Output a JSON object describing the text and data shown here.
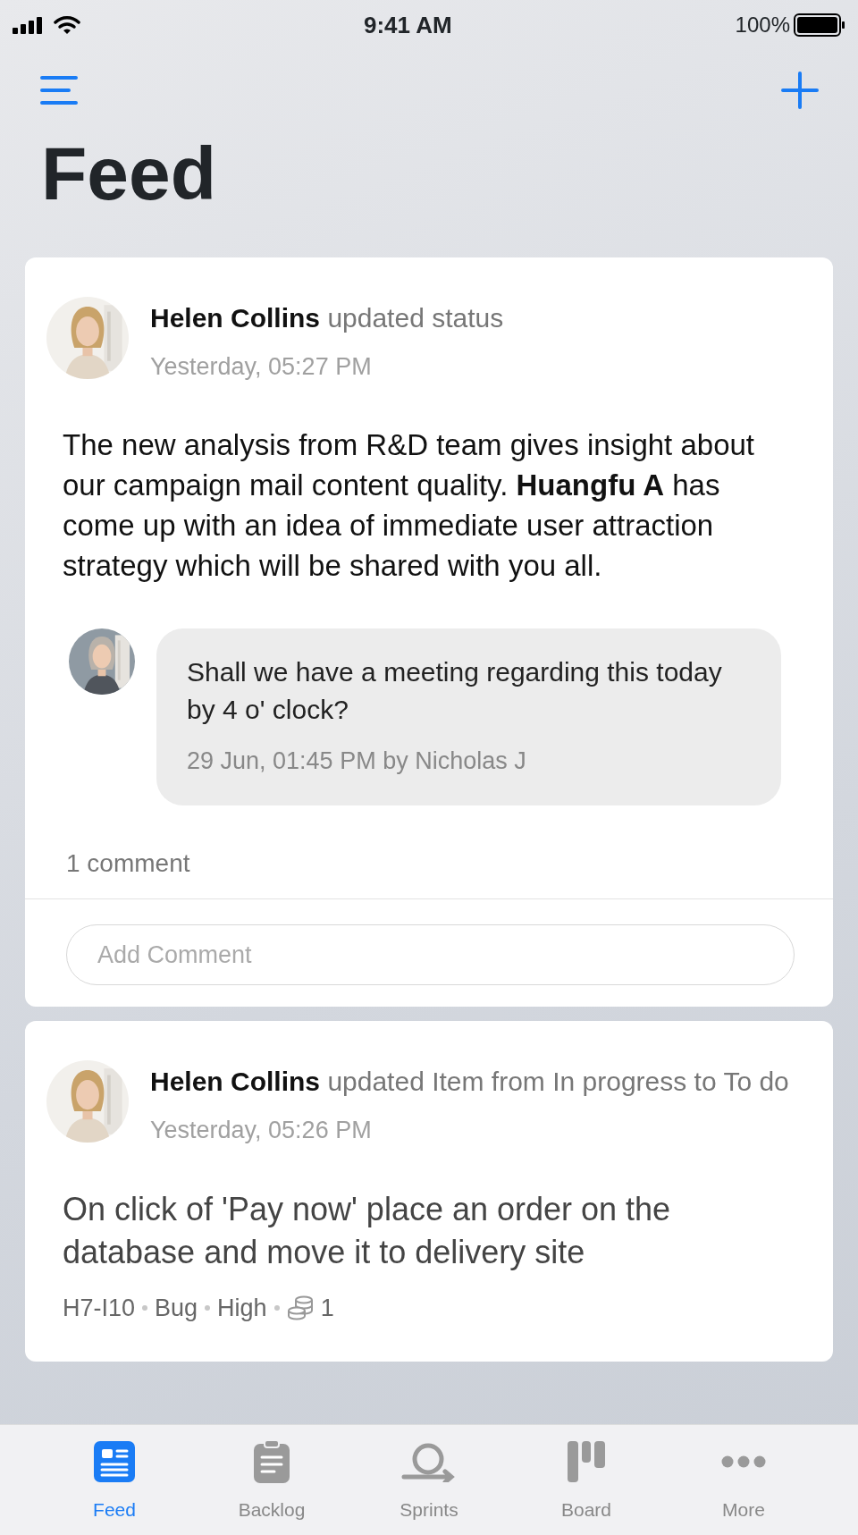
{
  "status_bar": {
    "time": "9:41 AM",
    "battery": "100%"
  },
  "title": "Feed",
  "feed": [
    {
      "kind": "status",
      "author": "Helen Collins",
      "action": "updated status",
      "time": "Yesterday, 05:27 PM",
      "body": "The new analysis from R&D team gives insight about our campaign  mail content quality. **Huangfu A** has come up with  an idea of immediate user attraction strategy which will be shared  with you all.",
      "comments": [
        {
          "text": "Shall we have a meeting regarding this today by 4 o' clock?",
          "meta": "29 Jun, 01:45 PM by Nicholas J"
        }
      ],
      "comment_count": "1 comment",
      "comment_field": {
        "placeholder": "Add Comment"
      }
    },
    {
      "kind": "item",
      "author": "Helen Collins",
      "action": "updated Item from In progress to To do",
      "time": "Yesterday, 05:26 PM",
      "item_title": "On click of 'Pay now' place an order on the database and move it to delivery site",
      "item_id": "H7-I10",
      "item_type": "Bug",
      "priority": "High",
      "points": "1"
    }
  ],
  "tabs": [
    {
      "label": "Feed",
      "selected": true
    },
    {
      "label": "Backlog",
      "selected": false
    },
    {
      "label": "Sprints",
      "selected": false
    },
    {
      "label": "Board",
      "selected": false
    },
    {
      "label": "More",
      "selected": false
    }
  ]
}
